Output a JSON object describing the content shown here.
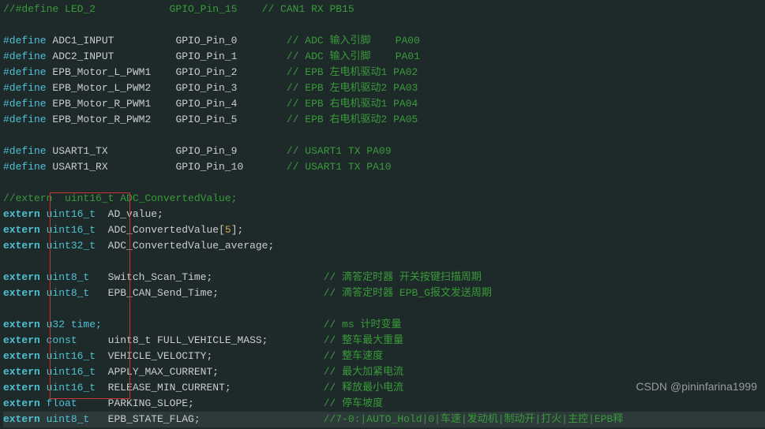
{
  "lines": [
    {
      "t": "comment",
      "text": "//#define LED_2            GPIO_Pin_15    // CAN1 RX PB15"
    },
    {
      "t": "blank",
      "text": ""
    },
    {
      "t": "def",
      "kw": "#define",
      "name": "ADC1_INPUT",
      "pin": "GPIO_Pin_0",
      "cm": "// ADC 输入引脚    PA00"
    },
    {
      "t": "def",
      "kw": "#define",
      "name": "ADC2_INPUT",
      "pin": "GPIO_Pin_1",
      "cm": "// ADC 输入引脚    PA01"
    },
    {
      "t": "def",
      "kw": "#define",
      "name": "EPB_Motor_L_PWM1",
      "pin": "GPIO_Pin_2",
      "cm": "// EPB 左电机驱动1 PA02"
    },
    {
      "t": "def",
      "kw": "#define",
      "name": "EPB_Motor_L_PWM2",
      "pin": "GPIO_Pin_3",
      "cm": "// EPB 左电机驱动2 PA03"
    },
    {
      "t": "def",
      "kw": "#define",
      "name": "EPB_Motor_R_PWM1",
      "pin": "GPIO_Pin_4",
      "cm": "// EPB 右电机驱动1 PA04"
    },
    {
      "t": "def",
      "kw": "#define",
      "name": "EPB_Motor_R_PWM2",
      "pin": "GPIO_Pin_5",
      "cm": "// EPB 右电机驱动2 PA05"
    },
    {
      "t": "blank",
      "text": ""
    },
    {
      "t": "def",
      "kw": "#define",
      "name": "USART1_TX",
      "pin": "GPIO_Pin_9",
      "cm": "// USART1 TX PA09"
    },
    {
      "t": "def",
      "kw": "#define",
      "name": "USART1_RX",
      "pin": "GPIO_Pin_10",
      "cm": "// USART1 TX PA10"
    },
    {
      "t": "blank",
      "text": ""
    },
    {
      "t": "comment",
      "text": "//extern  uint16_t ADC_ConvertedValue;"
    },
    {
      "t": "ext",
      "kw": "extern",
      "type": "uint16_t",
      "decl": "AD_value;",
      "cm": ""
    },
    {
      "t": "ext",
      "kw": "extern",
      "type": "uint16_t",
      "decl": "ADC_ConvertedValue[",
      "num": "5",
      "decl2": "];",
      "cm": ""
    },
    {
      "t": "ext",
      "kw": "extern",
      "type": "uint32_t",
      "decl": "ADC_ConvertedValue_average;",
      "cm": ""
    },
    {
      "t": "blank",
      "text": ""
    },
    {
      "t": "ext",
      "kw": "extern",
      "type": "uint8_t",
      "decl": "Switch_Scan_Time;",
      "cm": "// 滴答定时器 开关按键扫描周期"
    },
    {
      "t": "ext",
      "kw": "extern",
      "type": "uint8_t",
      "decl": "EPB_CAN_Send_Time;",
      "cm": "// 滴答定时器 EPB_G报文发送周期"
    },
    {
      "t": "blank",
      "text": ""
    },
    {
      "t": "ext",
      "kw": "extern",
      "type": "u32 time;",
      "decl": "",
      "cm": "// ms 计时变量"
    },
    {
      "t": "extc",
      "kw": "extern",
      "type": "const",
      "decl": "uint8_t FULL_VEHICLE_MASS;",
      "cm": "// 整车最大重量"
    },
    {
      "t": "ext",
      "kw": "extern",
      "type": "uint16_t",
      "decl": "VEHICLE_VELOCITY;",
      "cm": "// 整车速度"
    },
    {
      "t": "ext",
      "kw": "extern",
      "type": "uint16_t",
      "decl": "APPLY_MAX_CURRENT;",
      "cm": "// 最大加紧电流"
    },
    {
      "t": "ext",
      "kw": "extern",
      "type": "uint16_t",
      "decl": "RELEASE_MIN_CURRENT;",
      "cm": "// 释放最小电流"
    },
    {
      "t": "extc",
      "kw": "extern",
      "type": "float",
      "decl": "PARKING_SLOPE;",
      "cm": "// 停车坡度"
    },
    {
      "t": "ext",
      "kw": "extern",
      "type": "uint8_t",
      "decl": "EPB_STATE_FLAG;",
      "cm": "//7-0:|AUTO_Hold|0|车速|发动机|制动开|打火|主控|EPB释"
    }
  ],
  "watermark": "CSDN @pininfarina1999"
}
